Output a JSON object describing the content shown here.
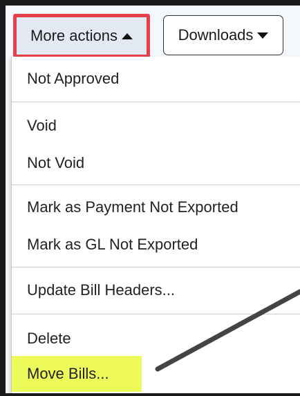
{
  "toolbar": {
    "more_actions_label": "More actions",
    "downloads_label": "Downloads"
  },
  "menu": {
    "items": [
      {
        "label": "Not Approved"
      },
      {
        "label": "Void"
      },
      {
        "label": "Not Void"
      },
      {
        "label": "Mark as Payment Not Exported"
      },
      {
        "label": "Mark as GL Not Exported"
      },
      {
        "label": "Update Bill Headers..."
      },
      {
        "label": "Delete"
      },
      {
        "label": "Move Bills..."
      }
    ]
  },
  "colors": {
    "highlight_box_border": "#e8404a",
    "highlighted_item_background": "#eef95a",
    "annotation_arrow": "#444444"
  },
  "icons": {
    "more_actions_caret": "caret-up-icon",
    "downloads_caret": "caret-down-icon"
  }
}
